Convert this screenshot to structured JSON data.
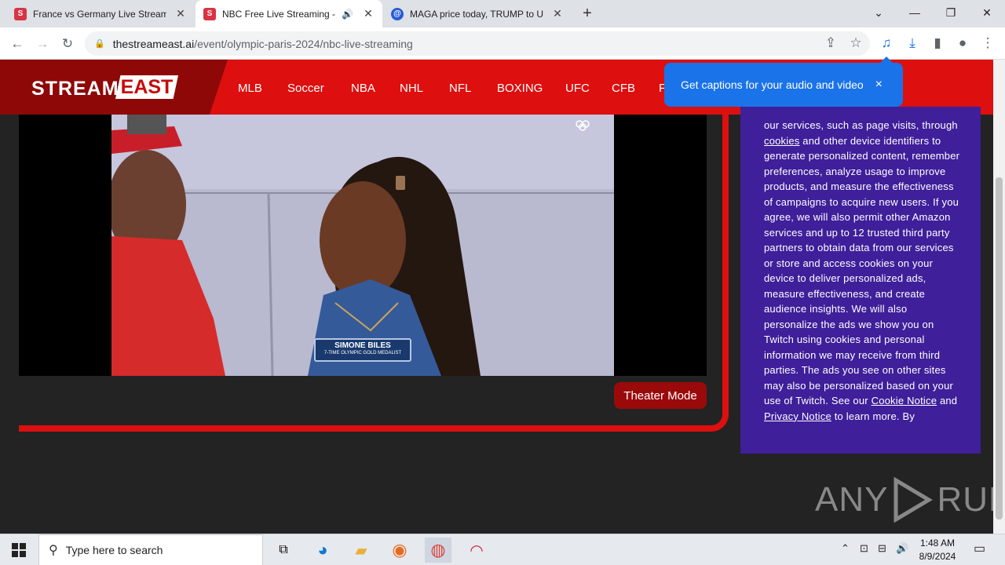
{
  "browser": {
    "tabs": [
      {
        "title": "France vs Germany Live Streamin",
        "favicon": "S",
        "favicon_color": "#d93444"
      },
      {
        "title": "NBC Free Live Streaming - S",
        "favicon": "S",
        "favicon_color": "#d93444"
      },
      {
        "title": "MAGA price today, TRUMP to US",
        "favicon": "@",
        "favicon_color": "#2a5bd7"
      }
    ],
    "new_tab": "+",
    "url_host": "thestreameast.ai",
    "url_path": "/event/olympic-paris-2024/nbc-live-streaming"
  },
  "site": {
    "logo_left": "STREAM",
    "logo_right": "EAST",
    "nav": [
      "MLB",
      "Soccer",
      "NBA",
      "NHL",
      "NFL",
      "BOXING",
      "UFC",
      "CFB",
      "F"
    ]
  },
  "captions_popup": {
    "text": "Get captions for your audio and video",
    "close": "×"
  },
  "player": {
    "lower_third_name": "SIMONE BILES",
    "lower_third_sub": "7-TIME OLYMPIC GOLD MEDALIST",
    "theater_button": "Theater Mode"
  },
  "consent": {
    "t1": "our services, such as page visits, through ",
    "link_cookies": "cookies",
    "t2": " and other device identifiers to generate personalized content, remember preferences, analyze usage to improve products, and measure the effectiveness of campaigns to acquire new users. If you agree, we will also permit other Amazon services and up to 12 trusted third party partners to obtain data from our services or store and access cookies on your device to deliver personalized ads, measure effectiveness, and create audience insights. We will also personalize the ads we show you on Twitch using cookies and personal information we may receive from third parties. The ads you see on other sites may also be personalized based on your use of Twitch. See our ",
    "link_cookie_notice": "Cookie Notice",
    "t3": " and ",
    "link_privacy": "Privacy Notice",
    "t4": " to learn more. By"
  },
  "watermark": {
    "left": "ANY",
    "right": "RUN"
  },
  "taskbar": {
    "search_placeholder": "Type here to search",
    "time": "1:48 AM",
    "date": "8/9/2024"
  }
}
